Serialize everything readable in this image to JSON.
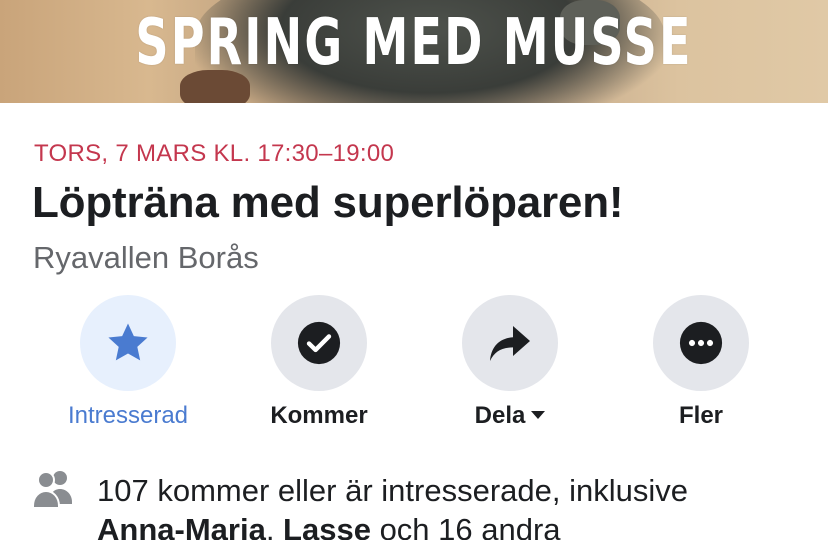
{
  "cover": {
    "title": "SPRING MED MUSSE"
  },
  "event": {
    "date": "TORS, 7 MARS KL. 17:30–19:00",
    "title": "Löpträna med superlöparen!",
    "location": "Ryavallen Borås"
  },
  "actions": [
    {
      "label": "Intresserad",
      "icon": "star-icon",
      "active": true
    },
    {
      "label": "Kommer",
      "icon": "check-circle-icon",
      "active": false
    },
    {
      "label": "Dela",
      "icon": "share-arrow-icon",
      "active": false,
      "has_dropdown": true
    },
    {
      "label": "Fler",
      "icon": "more-icon",
      "active": false
    }
  ],
  "attendees": {
    "icon": "people-icon",
    "text_prefix": "107 kommer eller är intresserade, inklusive",
    "friend_1": "Anna-Maria",
    "separator": ", ",
    "friend_2": "Lasse",
    "text_suffix": " och 16 andra"
  },
  "colors": {
    "date": "#c4374e",
    "active_blue": "#4a7bd0",
    "button_bg": "#e4e6eb",
    "active_button_bg": "#e7f0fd",
    "text_primary": "#1c1e21",
    "text_secondary": "#65676b"
  }
}
